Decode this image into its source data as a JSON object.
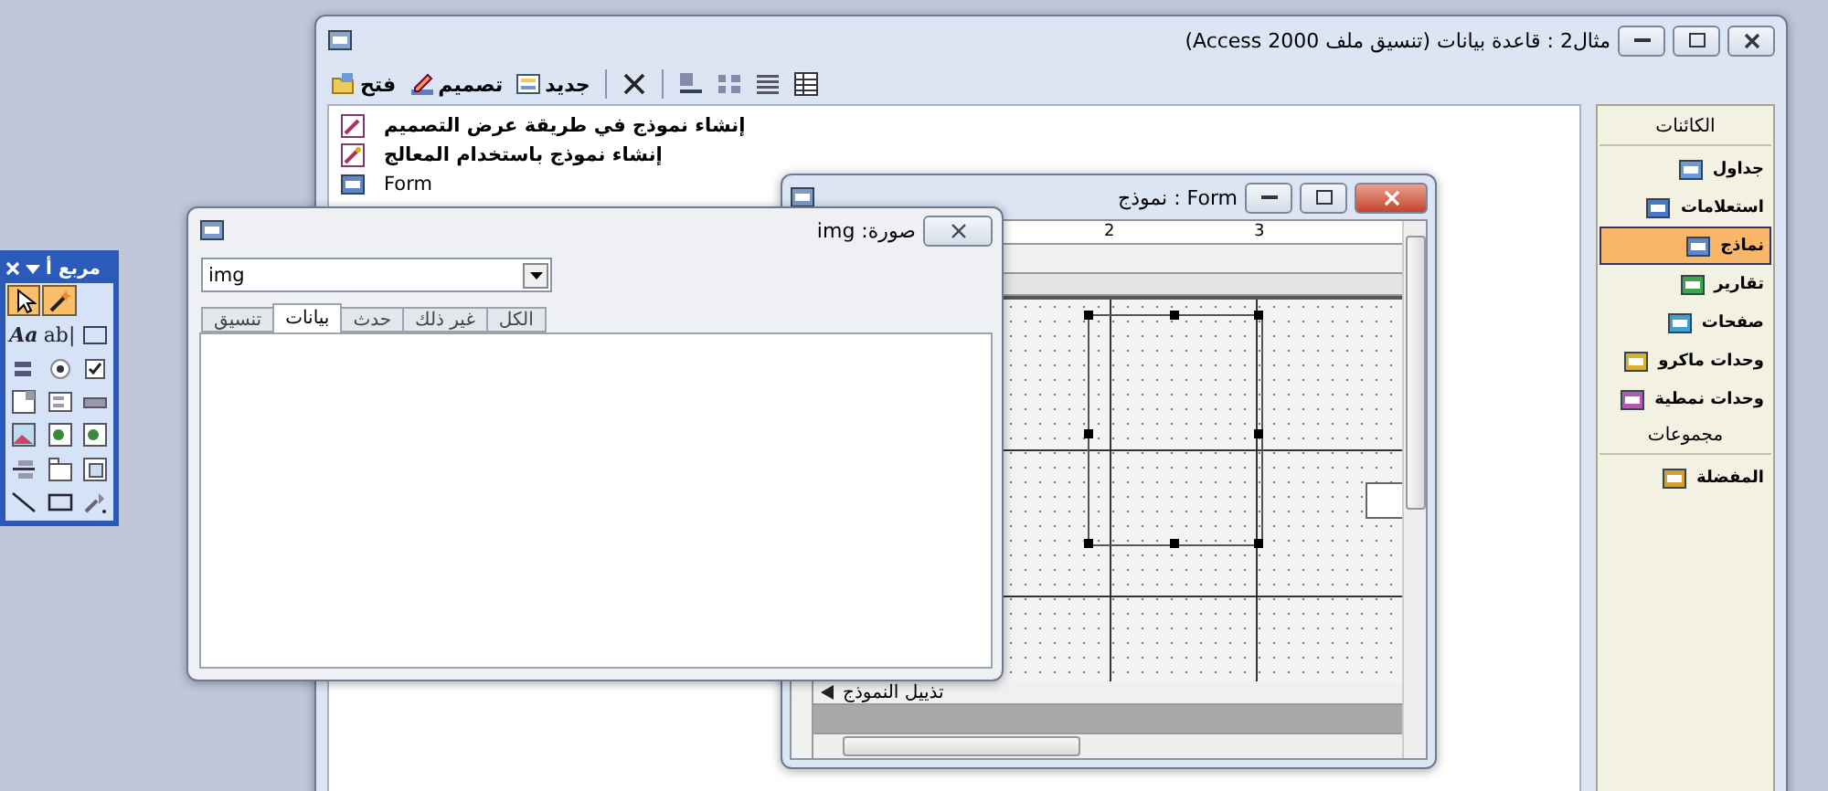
{
  "main_window": {
    "title": "مثال2 : قاعدة بيانات (تنسيق ملف Access 2000)",
    "toolbar": [
      {
        "kind": "details"
      },
      {
        "kind": "list"
      },
      {
        "kind": "small-icons"
      },
      {
        "kind": "large-icons"
      },
      {
        "kind": "delete"
      },
      {
        "kind": "new",
        "label": "جديد"
      },
      {
        "kind": "design",
        "label": "تصميم"
      },
      {
        "kind": "open",
        "label": "فتح"
      }
    ],
    "list_items": [
      {
        "kind": "design",
        "label": "إنشاء نموذج في طريقة عرض التصميم"
      },
      {
        "kind": "wizard",
        "label": "إنشاء نموذج باستخدام المعالج"
      },
      {
        "kind": "form",
        "label": "Form"
      }
    ],
    "sidebar": [
      {
        "header": "الكائنات",
        "items": [
          {
            "kind": "tables",
            "label": "جداول",
            "selected": false
          },
          {
            "kind": "queries",
            "label": "استعلامات",
            "selected": false
          },
          {
            "kind": "forms",
            "label": "نماذج",
            "selected": true
          },
          {
            "kind": "reports",
            "label": "تقارير",
            "selected": false
          },
          {
            "kind": "pages",
            "label": "صفحات",
            "selected": false
          },
          {
            "kind": "macros",
            "label": "وحدات ماكرو",
            "selected": false
          },
          {
            "kind": "modules",
            "label": "وحدات نمطية",
            "selected": false
          }
        ]
      },
      {
        "header": "مجموعات",
        "items": [
          {
            "kind": "favorites",
            "label": "المفضلة",
            "selected": false
          }
        ]
      }
    ]
  },
  "toolbox": {
    "title": "مربع أ",
    "tools": [
      {
        "kind": "wizard",
        "selected": true
      },
      {
        "kind": "pointer",
        "selected": true
      },
      {
        "kind": "frame",
        "selected": false
      },
      {
        "kind": "text",
        "text": "ab|",
        "selected": false
      },
      {
        "kind": "text",
        "text": "Aa",
        "selected": false
      },
      {
        "kind": "checkbox",
        "selected": false
      },
      {
        "kind": "radio",
        "selected": false
      },
      {
        "kind": "toggle",
        "selected": false
      },
      {
        "kind": "command",
        "selected": false
      },
      {
        "kind": "listbox",
        "selected": false
      },
      {
        "kind": "combo",
        "selected": false
      },
      {
        "kind": "object",
        "selected": false
      },
      {
        "kind": "object",
        "selected": false
      },
      {
        "kind": "image",
        "selected": false
      },
      {
        "kind": "subform",
        "selected": false
      },
      {
        "kind": "tabs",
        "selected": false
      },
      {
        "kind": "pagebreak",
        "selected": false
      },
      {
        "kind": "more",
        "selected": false
      },
      {
        "kind": "rectangle",
        "selected": false
      },
      {
        "kind": "line",
        "selected": false
      }
    ]
  },
  "form_window": {
    "title": "Form : نموذج",
    "ruler_marks": [
      "3",
      "2"
    ],
    "footer_label": "تذييل النموذج"
  },
  "property_sheet": {
    "title": "صورة: img",
    "object": "img",
    "tabs": [
      {
        "label": "الكل",
        "selected": false
      },
      {
        "label": "غير ذلك",
        "selected": false
      },
      {
        "label": "حدث",
        "selected": false
      },
      {
        "label": "بيانات",
        "selected": true
      },
      {
        "label": "تنسيق",
        "selected": false
      }
    ]
  }
}
